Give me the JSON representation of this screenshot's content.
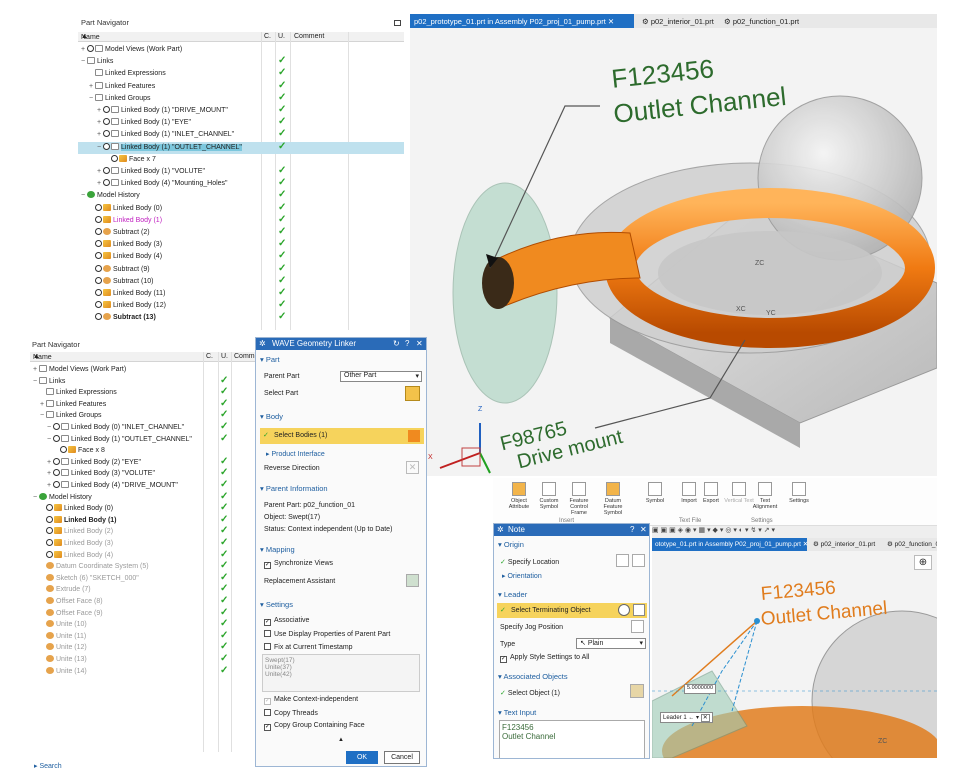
{
  "nav1": {
    "title": "Part Navigator",
    "columns": [
      "Name",
      "C.",
      "U.",
      "Comment"
    ],
    "rows": [
      {
        "label": "Model Views (Work Part)",
        "check": false
      },
      {
        "label": "Links",
        "check": true
      },
      {
        "label": "Linked Expressions",
        "check": true
      },
      {
        "label": "Linked Features",
        "check": true
      },
      {
        "label": "Linked Groups",
        "check": true
      },
      {
        "label": "Linked Body (1) \"DRIVE_MOUNT\"",
        "check": true
      },
      {
        "label": "Linked Body (1) \"EYE\"",
        "check": true
      },
      {
        "label": "Linked Body (1) \"INLET_CHANNEL\"",
        "check": true
      },
      {
        "label": "Linked Body (1) \"OUTLET_CHANNEL\"",
        "check": true
      },
      {
        "label": "Face x 7",
        "check": false
      },
      {
        "label": "Linked Body (1) \"VOLUTE\"",
        "check": true
      },
      {
        "label": "Linked Body (4) \"Mounting_Holes\"",
        "check": true
      },
      {
        "label": "Model History",
        "check": true
      },
      {
        "label": "Linked Body (0)",
        "check": true
      },
      {
        "label": "Linked Body (1)",
        "check": true
      },
      {
        "label": "Subtract (2)",
        "check": true
      },
      {
        "label": "Linked Body (3)",
        "check": true
      },
      {
        "label": "Linked Body (4)",
        "check": true
      },
      {
        "label": "Subtract (9)",
        "check": true
      },
      {
        "label": "Subtract (10)",
        "check": true
      },
      {
        "label": "Linked Body (11)",
        "check": true
      },
      {
        "label": "Linked Body (12)",
        "check": true
      },
      {
        "label": "Subtract (13)",
        "check": true
      }
    ]
  },
  "viewport1": {
    "tabs": [
      "p02_prototype_01.prt in Assembly P02_proj_01_pump.prt",
      "p02_interior_01.prt",
      "p02_function_01.prt"
    ],
    "note1_line1": "F123456",
    "note1_line2": "Outlet Channel",
    "note2_line1": "F98765",
    "note2_line2": "Drive mount",
    "axis_z": "Z",
    "axis_x": "X",
    "axis_zc": "ZC",
    "axis_xc": "XC",
    "axis_yc": "YC"
  },
  "nav2": {
    "title": "Part Navigator",
    "columns": [
      "Name",
      "C.",
      "U.",
      "Comm"
    ],
    "rows": [
      {
        "label": "Model Views (Work Part)",
        "check": false
      },
      {
        "label": "Links",
        "check": true
      },
      {
        "label": "Linked Expressions",
        "check": true
      },
      {
        "label": "Linked Features",
        "check": true
      },
      {
        "label": "Linked Groups",
        "check": true
      },
      {
        "label": "Linked Body (0) \"INLET_CHANNEL\"",
        "check": true
      },
      {
        "label": "Linked Body (1) \"OUTLET_CHANNEL\"",
        "check": true
      },
      {
        "label": "Face x 8",
        "check": false
      },
      {
        "label": "Linked Body (2) \"EYE\"",
        "check": true
      },
      {
        "label": "Linked Body (3) \"VOLUTE\"",
        "check": true
      },
      {
        "label": "Linked Body (4) \"DRIVE_MOUNT\"",
        "check": true
      },
      {
        "label": "Model History",
        "check": true
      },
      {
        "label": "Linked Body (0)",
        "check": true
      },
      {
        "label": "Linked Body (1)",
        "check": true
      },
      {
        "label": "Linked Body (2)",
        "check": true
      },
      {
        "label": "Linked Body (3)",
        "check": true
      },
      {
        "label": "Linked Body (4)",
        "check": true
      },
      {
        "label": "Datum Coordinate System (5)",
        "check": true
      },
      {
        "label": "Sketch (6) \"SKETCH_000\"",
        "check": true
      },
      {
        "label": "Extrude (7)",
        "check": true
      },
      {
        "label": "Offset Face (8)",
        "check": true
      },
      {
        "label": "Offset Face (9)",
        "check": true
      },
      {
        "label": "Unite (10)",
        "check": true
      },
      {
        "label": "Unite (11)",
        "check": true
      },
      {
        "label": "Unite (12)",
        "check": true
      },
      {
        "label": "Unite (13)",
        "check": true
      },
      {
        "label": "Unite (14)",
        "check": true
      }
    ],
    "search": "Search"
  },
  "wave": {
    "title": "WAVE Geometry Linker",
    "part_section": "Part",
    "parent_part_label": "Parent Part",
    "parent_part_value": "Other Part",
    "select_part_label": "Select Part",
    "body_section": "Body",
    "select_bodies": "Select Bodies (1)",
    "product_interface": "Product Interface",
    "reverse_direction": "Reverse Direction",
    "parent_info_section": "Parent Information",
    "parent_part_info": "Parent Part: p02_function_01",
    "object_info": "Object: Swept(17)",
    "status_info": "Status: Context independent (Up to Date)",
    "mapping_section": "Mapping",
    "sync_views": "Synchronize Views",
    "replacement_assistant": "Replacement Assistant",
    "settings_section": "Settings",
    "associative": "Associative",
    "use_display": "Use Display Properties of Parent Part",
    "fix_timestamp": "Fix at Current Timestamp",
    "list_items": [
      "Swept(17)",
      "Unite(37)",
      "Unite(42)"
    ],
    "make_ctx": "Make Context-independent",
    "copy_threads": "Copy Threads",
    "copy_group": "Copy Group Containing Face",
    "ok": "OK",
    "cancel": "Cancel"
  },
  "ribbon": {
    "items": [
      "Object Attribute",
      "Custom Symbol",
      "Feature Control Frame",
      "Datum Feature Symbol",
      "Symbol",
      "Import",
      "Export",
      "Vertical Text",
      "Text Alignment",
      "Settings"
    ],
    "group_insert": "Insert",
    "group_textfile": "Text File",
    "group_settings": "Settings"
  },
  "note": {
    "title": "Note",
    "origin_section": "Origin",
    "specify_location": "Specify Location",
    "orientation": "Orientation",
    "leader_section": "Leader",
    "select_terminating": "Select Terminating Object",
    "specify_jog": "Specify Jog Position",
    "type_label": "Type",
    "type_value": "Plain",
    "apply_style": "Apply Style Settings to All",
    "assoc_section": "Associated Objects",
    "select_object": "Select Object (1)",
    "text_input_section": "Text Input",
    "text_line1": "F123456",
    "text_line2": "Outlet Channel"
  },
  "viewport2": {
    "tabs": [
      "ototype_01.prt in Assembly P02_proj_01_pump.prt",
      "p02_interior_01.prt",
      "p02_function_0"
    ],
    "note_line1": "F123456",
    "note_line2": "Outlet Channel",
    "dim_value": "5.0000000",
    "leader_label": "Leader 1",
    "axis_zc": "ZC"
  }
}
